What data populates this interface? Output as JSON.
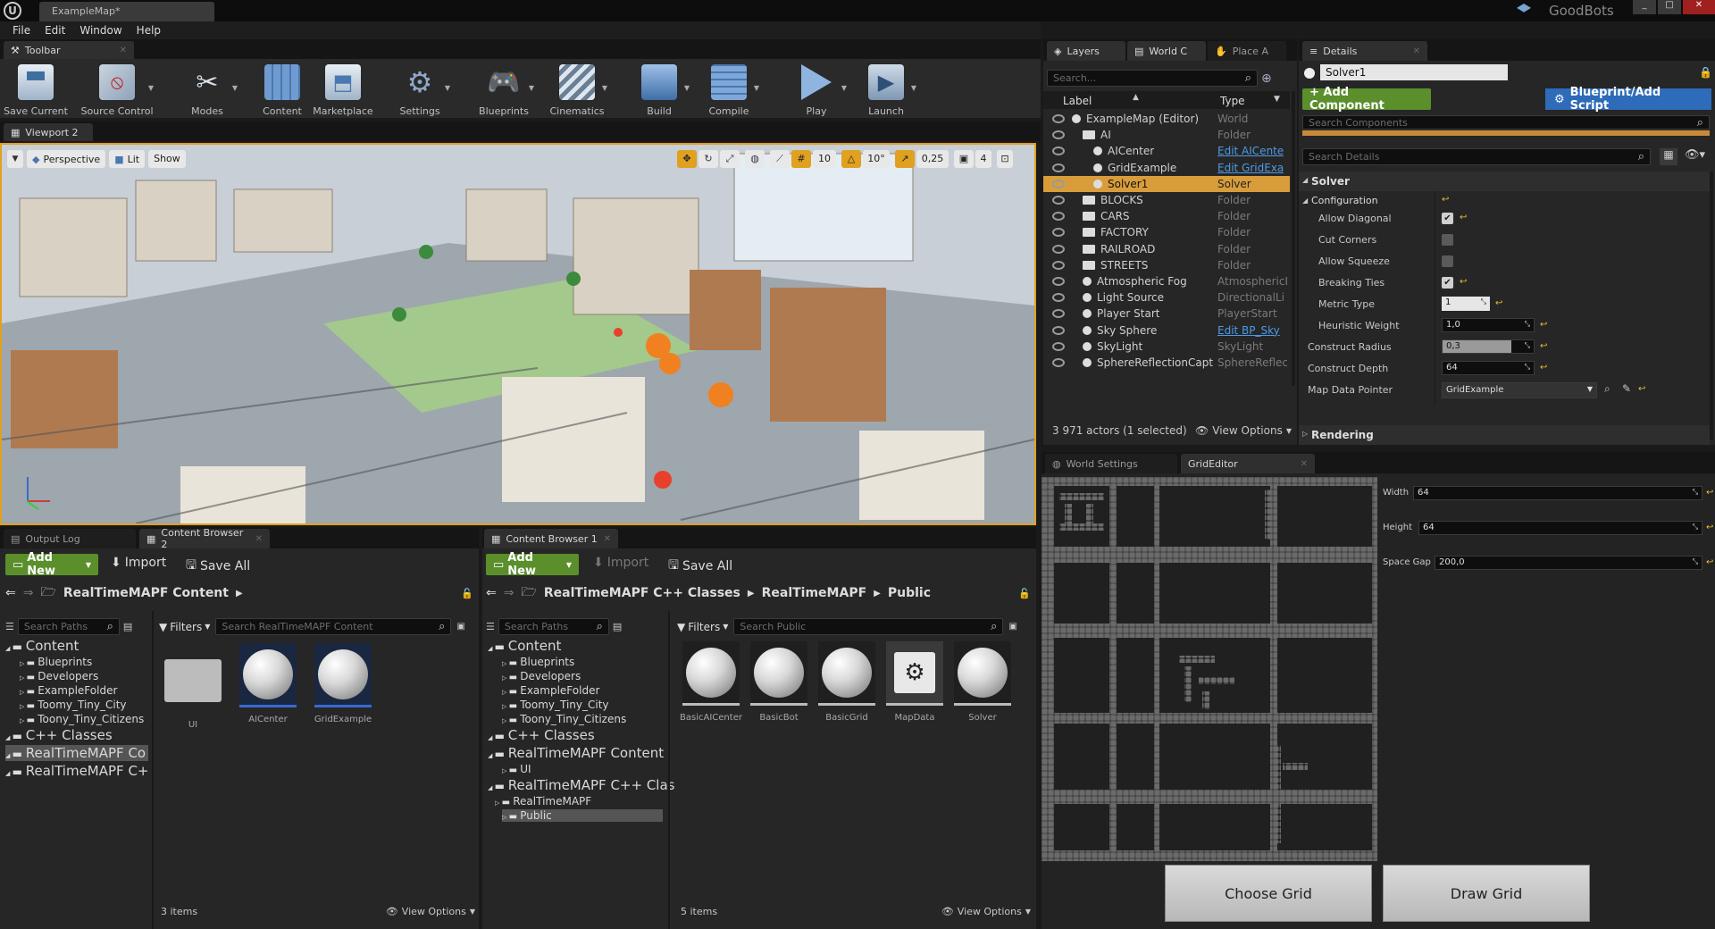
{
  "window": {
    "title": "ExampleMap",
    "title_suffix": "*",
    "brand": "GoodBots"
  },
  "menu": [
    "File",
    "Edit",
    "Window",
    "Help"
  ],
  "toolbar": {
    "tab": "Toolbar",
    "buttons": [
      {
        "label": "Save Current",
        "icon": "floppy-icon"
      },
      {
        "label": "Source Control",
        "icon": "source-control-icon"
      },
      {
        "label": "Modes",
        "icon": "modes-icon"
      },
      {
        "label": "Content",
        "icon": "content-icon"
      },
      {
        "label": "Marketplace",
        "icon": "marketplace-icon"
      },
      {
        "label": "Settings",
        "icon": "settings-icon"
      },
      {
        "label": "Blueprints",
        "icon": "blueprints-icon"
      },
      {
        "label": "Cinematics",
        "icon": "cinematics-icon"
      },
      {
        "label": "Build",
        "icon": "build-icon"
      },
      {
        "label": "Compile",
        "icon": "compile-icon"
      },
      {
        "label": "Play",
        "icon": "play-icon"
      },
      {
        "label": "Launch",
        "icon": "launch-icon"
      }
    ]
  },
  "viewport": {
    "tab": "Viewport 2",
    "perspective": "Perspective",
    "lit": "Lit",
    "show": "Show",
    "grid_snap": "10",
    "rot_snap": "10°",
    "scale_snap": "0,25",
    "camera_speed": "4"
  },
  "outliner": {
    "tabs": [
      "Layers",
      "World C",
      "Place A"
    ],
    "search_placeholder": "Search...",
    "col_label": "Label",
    "col_type": "Type",
    "rows": [
      {
        "label": "ExampleMap (Editor)",
        "type": "World",
        "link": false,
        "indent": 0
      },
      {
        "label": "AI",
        "type": "Folder",
        "link": false,
        "indent": 1
      },
      {
        "label": "AICenter",
        "type": "Edit AICente",
        "link": true,
        "indent": 2
      },
      {
        "label": "GridExample",
        "type": "Edit GridExa",
        "link": true,
        "indent": 2
      },
      {
        "label": "Solver1",
        "type": "Solver",
        "link": false,
        "indent": 2,
        "selected": true
      },
      {
        "label": "BLOCKS",
        "type": "Folder",
        "link": false,
        "indent": 1
      },
      {
        "label": "CARS",
        "type": "Folder",
        "link": false,
        "indent": 1
      },
      {
        "label": "FACTORY",
        "type": "Folder",
        "link": false,
        "indent": 1
      },
      {
        "label": "RAILROAD",
        "type": "Folder",
        "link": false,
        "indent": 1
      },
      {
        "label": "STREETS",
        "type": "Folder",
        "link": false,
        "indent": 1
      },
      {
        "label": "Atmospheric Fog",
        "type": "AtmosphericI",
        "link": false,
        "indent": 1
      },
      {
        "label": "Light Source",
        "type": "DirectionalLi",
        "link": false,
        "indent": 1
      },
      {
        "label": "Player Start",
        "type": "PlayerStart",
        "link": false,
        "indent": 1
      },
      {
        "label": "Sky Sphere",
        "type": "Edit BP_Sky",
        "link": true,
        "indent": 1
      },
      {
        "label": "SkyLight",
        "type": "SkyLight",
        "link": false,
        "indent": 1
      },
      {
        "label": "SphereReflectionCaptu",
        "type": "SphereReflec",
        "link": false,
        "indent": 1
      }
    ],
    "status": "3 971 actors (1 selected)",
    "view_options": "View Options"
  },
  "details": {
    "tab": "Details",
    "name": "Solver1",
    "add_component": "+ Add Component",
    "blueprint_script": "Blueprint/Add Script",
    "search_components": "Search Components",
    "search_details": "Search Details",
    "section_solver": "Solver",
    "section_configuration": "Configuration",
    "props": {
      "allow_diagonal": "Allow Diagonal",
      "cut_corners": "Cut Corners",
      "allow_squeeze": "Allow Squeeze",
      "breaking_ties": "Breaking Ties",
      "metric_type": "Metric Type",
      "metric_type_value": "1",
      "heuristic_weight": "Heuristic Weight",
      "heuristic_weight_value": "1,0",
      "construct_radius": "Construct Radius",
      "construct_radius_value": "0,3",
      "construct_depth": "Construct Depth",
      "construct_depth_value": "64",
      "map_data_pointer": "Map Data Pointer",
      "map_data_pointer_value": "GridExample"
    },
    "section_rendering": "Rendering"
  },
  "grid_editor": {
    "tabs": [
      "World Settings",
      "GridEditor"
    ],
    "width_label": "Width",
    "width_value": "64",
    "height_label": "Height",
    "height_value": "64",
    "gap_label": "Space Gap",
    "gap_value": "200,0",
    "choose_grid": "Choose Grid",
    "draw_grid": "Draw Grid"
  },
  "output_log": {
    "tab": "Output Log"
  },
  "cb2": {
    "tab": "Content Browser 2",
    "add_new": "Add New",
    "import": "Import",
    "save_all": "Save All",
    "path": "RealTimeMAPF Content",
    "search_paths": "Search Paths",
    "filters": "Filters",
    "search_content": "Search RealTimeMAPF Content",
    "tree": [
      {
        "label": "Content",
        "big": true,
        "indent": 0
      },
      {
        "label": "Blueprints",
        "big": false,
        "indent": 2
      },
      {
        "label": "Developers",
        "big": false,
        "indent": 2
      },
      {
        "label": "ExampleFolder",
        "big": false,
        "indent": 2
      },
      {
        "label": "Toomy_Tiny_City",
        "big": false,
        "indent": 2
      },
      {
        "label": "Toony_Tiny_Citizens",
        "big": false,
        "indent": 2
      },
      {
        "label": "C++ Classes",
        "big": true,
        "indent": 0
      },
      {
        "label": "RealTimeMAPF Co",
        "big": true,
        "indent": 0,
        "selected": true
      },
      {
        "label": "RealTimeMAPF C+",
        "big": true,
        "indent": 0
      }
    ],
    "assets": [
      "UI",
      "AICenter",
      "GridExample"
    ],
    "count": "3 items",
    "view_options": "View Options"
  },
  "cb1": {
    "tab": "Content Browser 1",
    "add_new": "Add New",
    "import": "Import",
    "save_all": "Save All",
    "path": [
      "RealTimeMAPF C++ Classes",
      "RealTimeMAPF",
      "Public"
    ],
    "search_paths": "Search Paths",
    "filters": "Filters",
    "search_content": "Search Public",
    "tree": [
      {
        "label": "Content",
        "big": true,
        "indent": 0
      },
      {
        "label": "Blueprints",
        "big": false,
        "indent": 2
      },
      {
        "label": "Developers",
        "big": false,
        "indent": 2
      },
      {
        "label": "ExampleFolder",
        "big": false,
        "indent": 2
      },
      {
        "label": "Toomy_Tiny_City",
        "big": false,
        "indent": 2
      },
      {
        "label": "Toony_Tiny_Citizens",
        "big": false,
        "indent": 2
      },
      {
        "label": "C++ Classes",
        "big": true,
        "indent": 0
      },
      {
        "label": "RealTimeMAPF Content",
        "big": true,
        "indent": 0
      },
      {
        "label": "UI",
        "big": false,
        "indent": 2
      },
      {
        "label": "RealTimeMAPF C++ Clas",
        "big": true,
        "indent": 0
      },
      {
        "label": "RealTimeMAPF",
        "big": false,
        "indent": 1
      },
      {
        "label": "Public",
        "big": false,
        "indent": 2,
        "selected": true
      }
    ],
    "assets": [
      "BasicAICenter",
      "BasicBot",
      "BasicGrid",
      "MapData",
      "Solver"
    ],
    "count": "5 items",
    "view_options": "View Options"
  }
}
